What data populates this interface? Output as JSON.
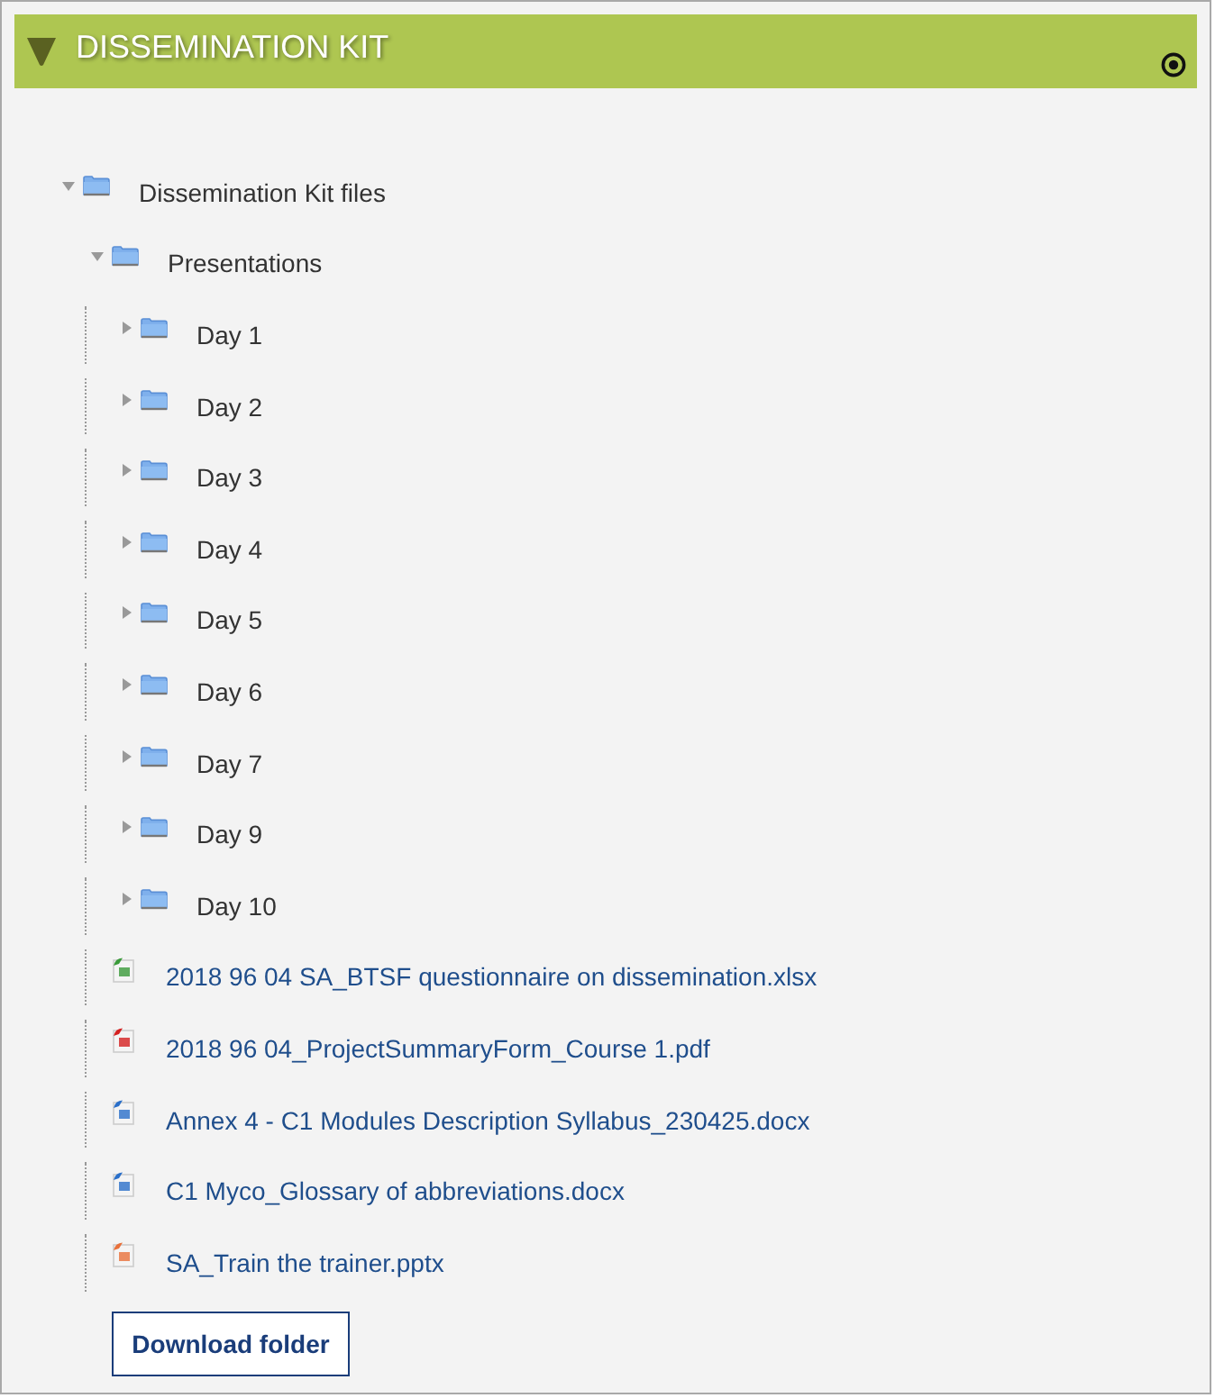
{
  "block": {
    "title": "DISSEMINATION KIT"
  },
  "tree": {
    "label": "Dissemination Kit files",
    "kind": "folder",
    "expanded": true,
    "children": [
      {
        "label": "Presentations",
        "kind": "folder",
        "expanded": true,
        "children": [
          {
            "label": "Day 1",
            "kind": "folder",
            "expanded": false
          },
          {
            "label": "Day 2",
            "kind": "folder",
            "expanded": false
          },
          {
            "label": "Day 3",
            "kind": "folder",
            "expanded": false
          },
          {
            "label": "Day 4",
            "kind": "folder",
            "expanded": false
          },
          {
            "label": "Day 5",
            "kind": "folder",
            "expanded": false
          },
          {
            "label": "Day 6",
            "kind": "folder",
            "expanded": false
          },
          {
            "label": "Day 7",
            "kind": "folder",
            "expanded": false
          },
          {
            "label": "Day 9",
            "kind": "folder",
            "expanded": false
          },
          {
            "label": "Day 10",
            "kind": "folder",
            "expanded": false
          }
        ]
      },
      {
        "label": "2018 96 04 SA_BTSF questionnaire on dissemination.xlsx",
        "kind": "spreadsheet"
      },
      {
        "label": "2018 96 04_ProjectSummaryForm_Course 1.pdf",
        "kind": "pdf"
      },
      {
        "label": "Annex 4 - C1 Modules Description Syllabus_230425.docx",
        "kind": "document"
      },
      {
        "label": "C1 Myco_Glossary of abbreviations.docx",
        "kind": "document"
      },
      {
        "label": "SA_Train the trainer.pptx",
        "kind": "slides"
      }
    ]
  },
  "download_button": "Download folder"
}
